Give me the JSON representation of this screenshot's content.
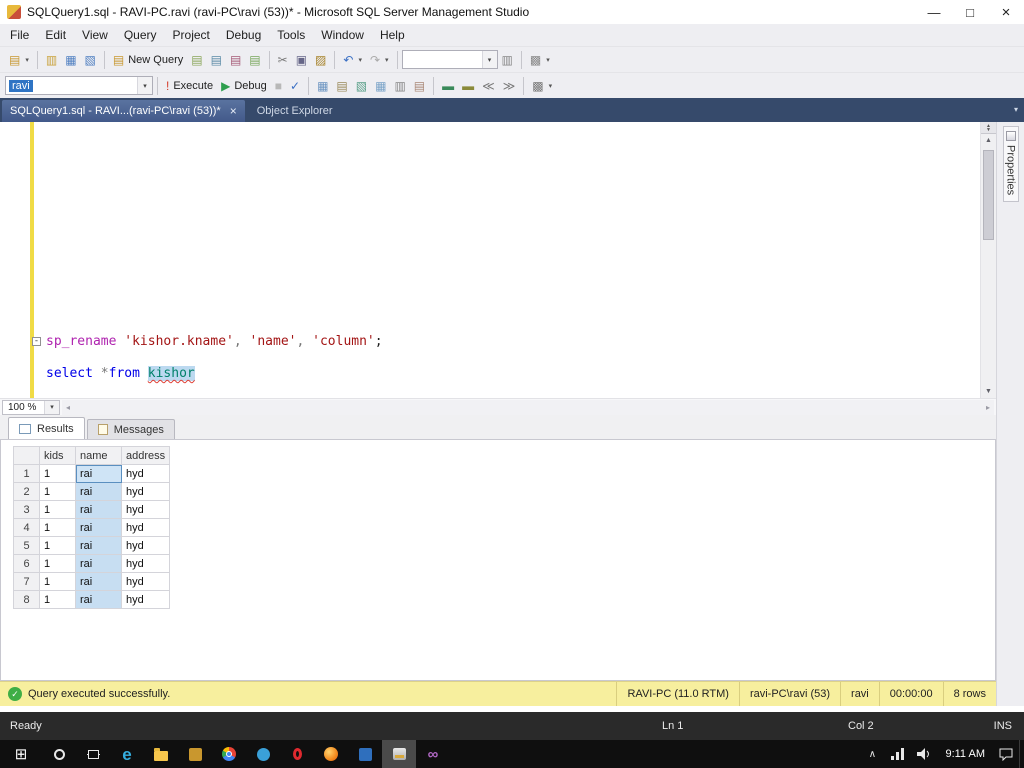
{
  "window": {
    "title": "SQLQuery1.sql - RAVI-PC.ravi (ravi-PC\\ravi (53))* - Microsoft SQL Server Management Studio"
  },
  "glyphs": {
    "minimize": "—",
    "maximize": "□",
    "close": "×",
    "close_tab": "×",
    "dropdown": "▾",
    "scroll_up": "▲",
    "scroll_down": "▼",
    "scroll_left": "◂",
    "scroll_right": "▸",
    "check": "✓"
  },
  "menu": {
    "items": [
      "File",
      "Edit",
      "View",
      "Query",
      "Project",
      "Debug",
      "Tools",
      "Window",
      "Help"
    ]
  },
  "toolbar_standard": {
    "items": [
      {
        "type": "button",
        "name": "new-query-dropdown-button",
        "glyph": "▤",
        "color": "#c89830",
        "dd": true
      },
      {
        "type": "sep"
      },
      {
        "type": "button",
        "name": "open-file-button",
        "glyph": "▥",
        "color": "#caa23c"
      },
      {
        "type": "button",
        "name": "save-button",
        "glyph": "▦",
        "color": "#4f7fc1"
      },
      {
        "type": "button",
        "name": "save-all-button",
        "glyph": "▧",
        "color": "#4f7fc1"
      },
      {
        "type": "sep"
      },
      {
        "type": "button",
        "name": "new-query-button",
        "glyph": "▤",
        "color": "#c89830",
        "label": "New Query"
      },
      {
        "type": "button",
        "name": "database-engine-query-button",
        "glyph": "▤",
        "color": "#8aa65a"
      },
      {
        "type": "button",
        "name": "analysis-services-query-button",
        "glyph": "▤",
        "color": "#5a8aa6"
      },
      {
        "type": "button",
        "name": "mdx-query-button",
        "glyph": "▤",
        "color": "#a65a77"
      },
      {
        "type": "button",
        "name": "xmla-query-button",
        "glyph": "▤",
        "color": "#77a65a"
      },
      {
        "type": "sep"
      },
      {
        "type": "button",
        "name": "cut-button",
        "glyph": "✂",
        "color": "#777777"
      },
      {
        "type": "button",
        "name": "copy-button",
        "glyph": "▣",
        "color": "#666688"
      },
      {
        "type": "button",
        "name": "paste-button",
        "glyph": "▨",
        "color": "#a8842c"
      },
      {
        "type": "sep"
      },
      {
        "type": "button",
        "name": "undo-button",
        "glyph": "↶",
        "color": "#3a6fc4",
        "dd": true
      },
      {
        "type": "button",
        "name": "redo-button",
        "glyph": "↷",
        "color": "#aaaaaa",
        "dd": true
      },
      {
        "type": "sep"
      },
      {
        "type": "combo",
        "name": "find-combo",
        "width": 96,
        "text": ""
      },
      {
        "type": "button",
        "name": "find-button",
        "glyph": "▥",
        "color": "#888888"
      },
      {
        "type": "sep"
      },
      {
        "type": "button",
        "name": "activity-monitor-button",
        "glyph": "▩",
        "color": "#888888",
        "dd": true
      }
    ]
  },
  "toolbar_sql": {
    "items": [
      {
        "type": "combo",
        "name": "database-combo",
        "width": 148,
        "text": "ravi",
        "selected": true
      },
      {
        "type": "sep"
      },
      {
        "type": "button",
        "name": "execute-button",
        "glyph": "!",
        "color": "#d43b2a",
        "label": "Execute"
      },
      {
        "type": "button",
        "name": "debug-button",
        "glyph": "▶",
        "color": "#2e9e4e",
        "label": "Debug"
      },
      {
        "type": "button",
        "name": "stop-button",
        "glyph": "■",
        "color": "#b8b8b8"
      },
      {
        "type": "button",
        "name": "parse-button",
        "glyph": "✓",
        "color": "#3a6fc4"
      },
      {
        "type": "sep"
      },
      {
        "type": "button",
        "name": "estimated-plan-button",
        "glyph": "▦",
        "color": "#6a93c0"
      },
      {
        "type": "button",
        "name": "query-options-button",
        "glyph": "▤",
        "color": "#9a8a5a"
      },
      {
        "type": "button",
        "name": "intellisense-button",
        "glyph": "▧",
        "color": "#5aa08a"
      },
      {
        "type": "button",
        "name": "results-to-grid-button",
        "glyph": "▦",
        "color": "#7aa3c8"
      },
      {
        "type": "button",
        "name": "results-to-text-button",
        "glyph": "▥",
        "color": "#888888"
      },
      {
        "type": "button",
        "name": "results-to-file-button",
        "glyph": "▤",
        "color": "#aa8877"
      },
      {
        "type": "sep"
      },
      {
        "type": "button",
        "name": "comment-button",
        "glyph": "▬",
        "color": "#3a8a5a"
      },
      {
        "type": "button",
        "name": "uncomment-button",
        "glyph": "▬",
        "color": "#8a8a3a"
      },
      {
        "type": "button",
        "name": "decrease-indent-button",
        "glyph": "≪",
        "color": "#777777"
      },
      {
        "type": "button",
        "name": "increase-indent-button",
        "glyph": "≫",
        "color": "#777777"
      },
      {
        "type": "sep"
      },
      {
        "type": "button",
        "name": "sort-button",
        "glyph": "▩",
        "color": "#777777",
        "dd": true
      }
    ]
  },
  "tabstrip": {
    "document_tab": "SQLQuery1.sql - RAVI...(ravi-PC\\ravi (53))*",
    "object_explorer_tab": "Object Explorer"
  },
  "editor": {
    "zoom_value": "100 %",
    "code_lines": [
      {
        "outline": "-",
        "tokens": [
          {
            "text": "sp_rename",
            "style": "sysproc"
          },
          {
            "text": " ",
            "style": "plain"
          },
          {
            "text": "'kishor.kname'",
            "style": "string"
          },
          {
            "text": ", ",
            "style": "operator"
          },
          {
            "text": "'name'",
            "style": "string"
          },
          {
            "text": ", ",
            "style": "operator"
          },
          {
            "text": "'column'",
            "style": "string"
          },
          {
            "text": ";",
            "style": "plain"
          }
        ]
      },
      {
        "tokens": []
      },
      {
        "tokens": [
          {
            "text": "select",
            "style": "keyword"
          },
          {
            "text": " ",
            "style": "plain"
          },
          {
            "text": "*",
            "style": "operator"
          },
          {
            "text": "from",
            "style": "keyword"
          },
          {
            "text": " ",
            "style": "plain"
          },
          {
            "text": "kishor",
            "style": "table",
            "selected": true,
            "error": true
          }
        ]
      }
    ]
  },
  "results": {
    "tab_results": "Results",
    "tab_messages": "Messages",
    "grid": {
      "columns": [
        "kids",
        "name",
        "address"
      ],
      "selected_column": "name",
      "rows": [
        {
          "n": "1",
          "kids": "1",
          "name": "rai",
          "address": "hyd"
        },
        {
          "n": "2",
          "kids": "1",
          "name": "rai",
          "address": "hyd"
        },
        {
          "n": "3",
          "kids": "1",
          "name": "rai",
          "address": "hyd"
        },
        {
          "n": "4",
          "kids": "1",
          "name": "rai",
          "address": "hyd"
        },
        {
          "n": "5",
          "kids": "1",
          "name": "rai",
          "address": "hyd"
        },
        {
          "n": "6",
          "kids": "1",
          "name": "rai",
          "address": "hyd"
        },
        {
          "n": "7",
          "kids": "1",
          "name": "rai",
          "address": "hyd"
        },
        {
          "n": "8",
          "kids": "1",
          "name": "rai",
          "address": "hyd"
        }
      ]
    }
  },
  "exec_status": {
    "message": "Query executed successfully.",
    "server": "RAVI-PC (11.0 RTM)",
    "user": "ravi-PC\\ravi (53)",
    "database": "ravi",
    "duration": "00:00:00",
    "row_count": "8 rows"
  },
  "status_bar": {
    "state": "Ready",
    "line": "Ln 1",
    "column": "Col 2",
    "mode": "INS"
  },
  "side_panel": {
    "properties_label": "Properties"
  },
  "taskbar": {
    "time": "9:11 AM",
    "apps": [
      {
        "name": "start-button",
        "kind": "start",
        "glyph": "⊞"
      },
      {
        "name": "search-button",
        "kind": "search"
      },
      {
        "name": "task-view-button",
        "kind": "taskview"
      },
      {
        "name": "edge-browser-icon",
        "kind": "edge",
        "glyph": "e"
      },
      {
        "name": "file-explorer-icon",
        "kind": "explorer"
      },
      {
        "name": "store-app-icon",
        "kind": "square",
        "color": "#c9972e"
      },
      {
        "name": "chrome-browser-icon",
        "kind": "chrome"
      },
      {
        "name": "app-circle-icon",
        "kind": "circle",
        "color": "#3aa0d8"
      },
      {
        "name": "opera-browser-icon",
        "kind": "opera"
      },
      {
        "name": "firefox-browser-icon",
        "kind": "firefox"
      },
      {
        "name": "app-square-icon",
        "kind": "square",
        "color": "#2f6fbd"
      },
      {
        "name": "ssms-taskbar-icon",
        "kind": "ssms",
        "active": true
      },
      {
        "name": "visual-studio-icon",
        "kind": "vs",
        "glyph": "∞",
        "color": "#b168c4"
      }
    ],
    "tray_icons": [
      {
        "name": "tray-expand-icon",
        "kind": "chevron",
        "glyph": "∧"
      },
      {
        "name": "network-icon",
        "kind": "network"
      },
      {
        "name": "volume-icon",
        "kind": "volume"
      }
    ]
  }
}
